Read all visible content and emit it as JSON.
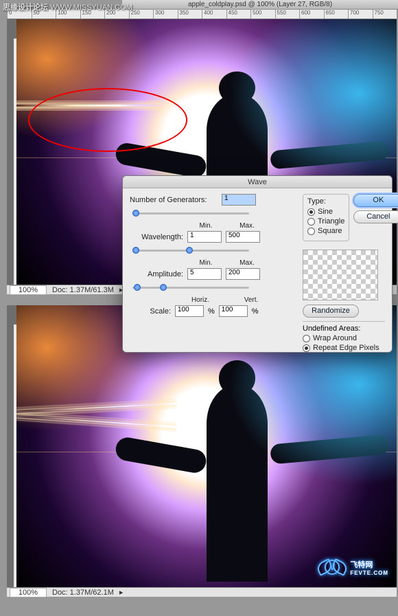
{
  "watermark": {
    "site_cn": "思缘设计论坛",
    "site_url": "WWW.MISSYUAN.COM"
  },
  "title_bar": "apple_coldplay.psd @ 100% (Layer 27, RGB/8)",
  "ruler_ticks": [
    "0",
    "50",
    "100",
    "150",
    "200",
    "250",
    "300",
    "350",
    "400",
    "450",
    "500",
    "550",
    "600",
    "650",
    "700",
    "750"
  ],
  "status": {
    "zoom": "100%",
    "doc_top": "Doc: 1.37M/61.3M",
    "doc_bottom": "Doc: 1.37M/62.1M"
  },
  "dialog": {
    "title": "Wave",
    "num_generators_label": "Number of Generators:",
    "num_generators_value": "1",
    "min_label": "Min.",
    "max_label": "Max.",
    "wavelength_label": "Wavelength:",
    "wavelength_min": "1",
    "wavelength_max": "500",
    "amplitude_label": "Amplitude:",
    "amplitude_min": "5",
    "amplitude_max": "200",
    "scale_label": "Scale:",
    "horiz_label": "Horiz.",
    "vert_label": "Vert.",
    "scale_h": "100",
    "scale_v": "100",
    "percent": "%",
    "type_legend": "Type:",
    "type_sine": "Sine",
    "type_triangle": "Triangle",
    "type_square": "Square",
    "ok": "OK",
    "cancel": "Cancel",
    "randomize": "Randomize",
    "undefined_legend": "Undefined Areas:",
    "wrap": "Wrap Around",
    "repeat": "Repeat Edge Pixels"
  },
  "logo": {
    "text": "飞特网",
    "url": "FEVTE.COM",
    "letter": "V"
  }
}
